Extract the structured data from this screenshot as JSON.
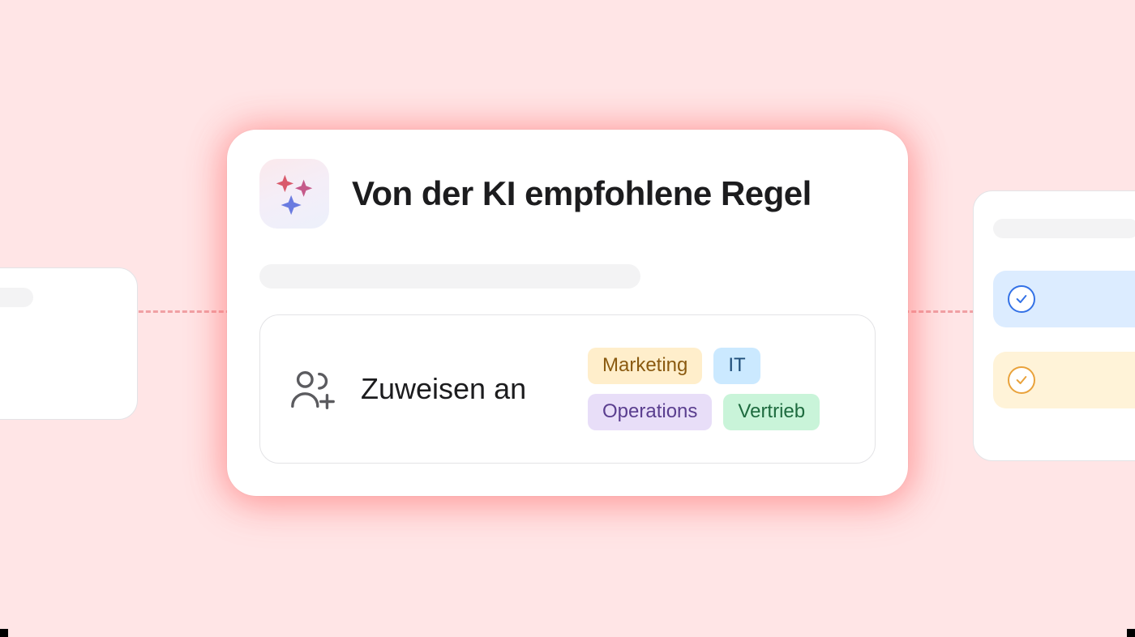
{
  "main": {
    "title": "Von der KI empfohlene Regel",
    "assign_label": "Zuweisen an",
    "tags": [
      {
        "label": "Marketing",
        "class": "tag-marketing"
      },
      {
        "label": "IT",
        "class": "tag-it"
      },
      {
        "label": "Operations",
        "class": "tag-operations"
      },
      {
        "label": "Vertrieb",
        "class": "tag-vertrieb"
      }
    ]
  },
  "icons": {
    "ai_sparkle": "ai-sparkle-icon",
    "assign": "add-user-icon",
    "check": "check-icon"
  }
}
